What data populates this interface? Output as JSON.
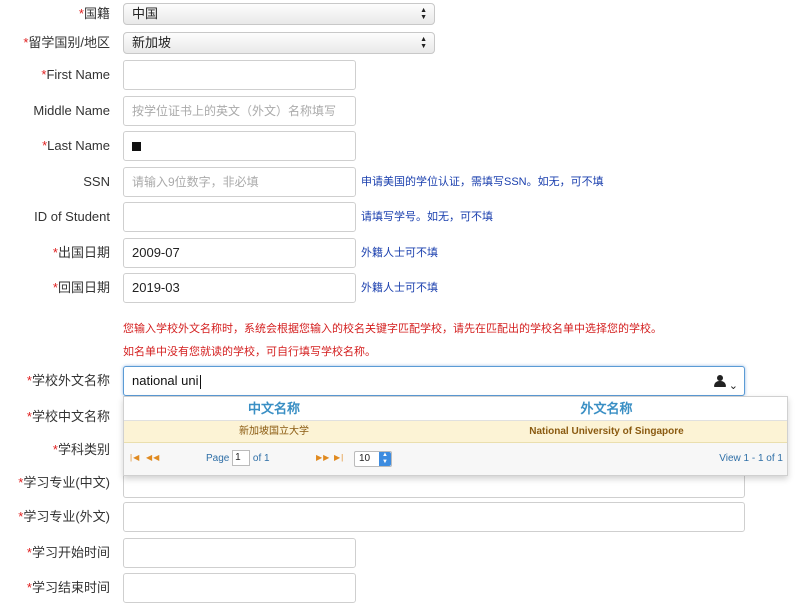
{
  "form": {
    "nationality": {
      "label": "国籍",
      "value": "中国"
    },
    "study_country": {
      "label": "留学国别/地区",
      "value": "新加坡"
    },
    "first_name": {
      "label": "First Name",
      "value": ""
    },
    "middle_name": {
      "label": "Middle Name",
      "placeholder": "按学位证书上的英文（外文）名称填写"
    },
    "last_name": {
      "label": "Last Name",
      "value": ""
    },
    "ssn": {
      "label": "SSN",
      "placeholder": "请输入9位数字，非必填",
      "hint": "申请美国的学位认证，需填写SSN。如无，可不填"
    },
    "student_id": {
      "label": "ID of Student",
      "value": "",
      "hint": "请填写学号。如无，可不填"
    },
    "depart_date": {
      "label": "出国日期",
      "value": "2009-07",
      "hint": "外籍人士可不填"
    },
    "return_date": {
      "label": "回国日期",
      "value": "2019-03",
      "hint": "外籍人士可不填"
    },
    "notice_line1": "您输入学校外文名称时，系统会根据您输入的校名关键字匹配学校，请先在匹配出的学校名单中选择您的学校。",
    "notice_line2": "如名单中没有您就读的学校，可自行填写学校名称。",
    "school_foreign": {
      "label": "学校外文名称",
      "value": "national uni"
    },
    "school_chinese": {
      "label": "学校中文名称"
    },
    "subject_category": {
      "label": "学科类别"
    },
    "major_chinese": {
      "label": "学习专业(中文)"
    },
    "major_foreign": {
      "label": "学习专业(外文)"
    },
    "start_time": {
      "label": "学习开始时间"
    },
    "end_time": {
      "label": "学习结束时间"
    },
    "required_mark": "*"
  },
  "autocomplete": {
    "columns": [
      "中文名称",
      "外文名称"
    ],
    "rows": [
      {
        "chinese": "新加坡国立大学",
        "foreign": "National University of Singapore"
      }
    ],
    "pager": {
      "page_label": "Page",
      "page_value": "1",
      "of_label": "of 1",
      "page_size": "10",
      "view_text": "View 1 - 1 of 1"
    }
  },
  "icons": [
    "user-icon",
    "chevron-down-icon",
    "first-page-icon",
    "prev-page-icon",
    "next-page-icon",
    "last-page-icon"
  ],
  "colors": {
    "required": "#e02020",
    "hint": "#1a3fae",
    "notice": "#d42020",
    "header": "#3a8fc4",
    "highlight_row": "#fcf3d5"
  }
}
